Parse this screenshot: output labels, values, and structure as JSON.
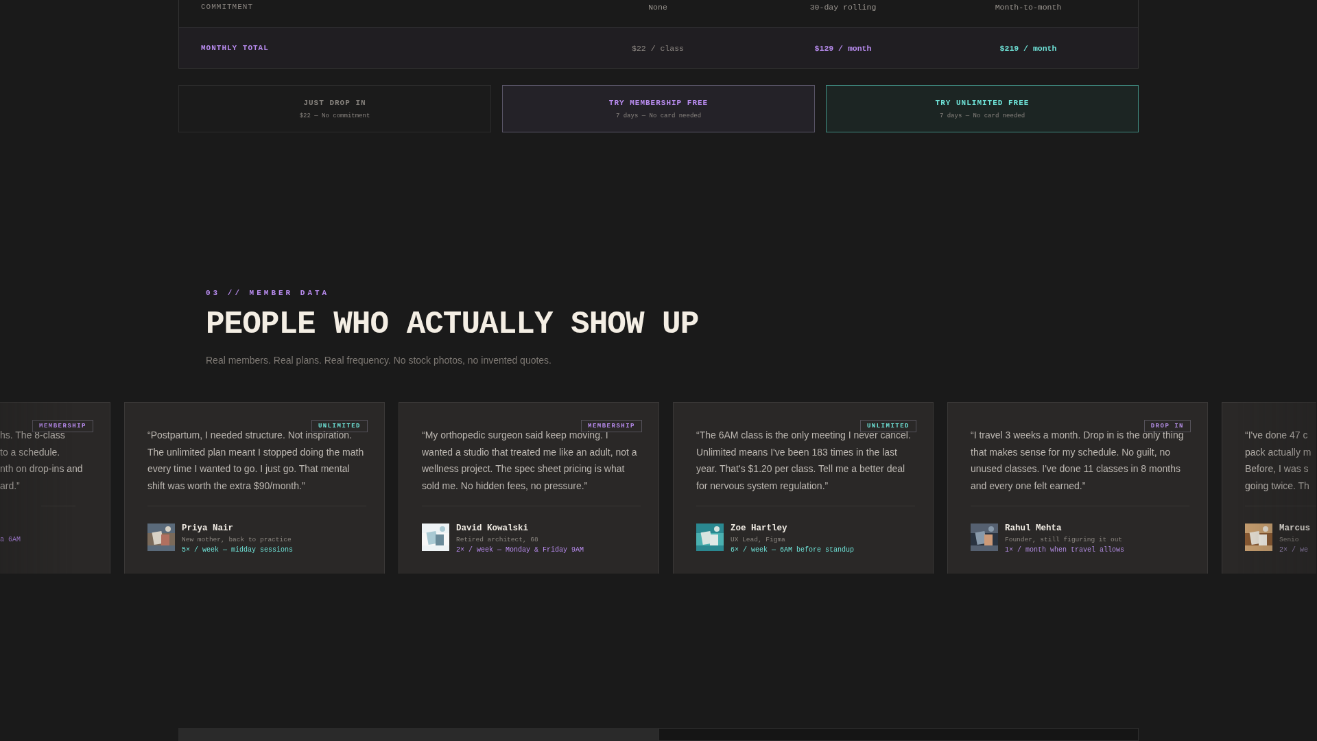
{
  "comparison_table": {
    "rows": [
      {
        "kind": "plain",
        "label": "COMMITMENT",
        "cells": [
          {
            "text": "None",
            "color": "#9a958f"
          },
          {
            "text": "30-day rolling",
            "color": "#9a958f"
          },
          {
            "text": "Month-to-month",
            "color": "#9a958f"
          }
        ]
      },
      {
        "kind": "total",
        "label": "MONTHLY TOTAL",
        "cells": [
          {
            "text": "$22 / class",
            "color": "#8f8a85"
          },
          {
            "text": "$129 / month",
            "color": "#b98cf0"
          },
          {
            "text": "$219 / month",
            "color": "#6fe3d8"
          }
        ]
      }
    ]
  },
  "cta_buttons": [
    {
      "kind": "plain",
      "title": "JUST DROP IN",
      "subtitle": "$22 — No commitment"
    },
    {
      "kind": "membership",
      "title": "TRY MEMBERSHIP FREE",
      "subtitle": "7 days — No card needed"
    },
    {
      "kind": "unlimited",
      "title": "TRY UNLIMITED FREE",
      "subtitle": "7 days — No card needed"
    }
  ],
  "section": {
    "eyebrow": "03 // MEMBER DATA",
    "title": "PEOPLE WHO ACTUALLY SHOW UP",
    "subtitle": "Real members. Real plans. Real frequency. No stock photos, no invented quotes."
  },
  "testimonials": [
    {
      "kind": "partial_left",
      "badge": "MEMBERSHIP",
      "color": "#b98cf0",
      "quote_lines": [
        "hs. The 8-class",
        "to a schedule.",
        "nth on drop-ins and",
        "ard.”"
      ],
      "frequency": "a 6AM"
    },
    {
      "kind": "full",
      "badge": "UNLIMITED",
      "color": "#6fe3d8",
      "quote": "“Postpartum, I needed structure. Not inspiration. The unlimited plan meant I stopped doing the math every time I wanted to go. I just go. That mental shift was worth the extra $90/month.”",
      "name": "Priya Nair",
      "role": "New mother, back to practice",
      "frequency": "5× / week — midday sessions"
    },
    {
      "kind": "full",
      "badge": "MEMBERSHIP",
      "color": "#b98cf0",
      "quote": "“My orthopedic surgeon said keep moving. I wanted a studio that treated me like an adult, not a wellness project. The spec sheet pricing is what sold me. No hidden fees, no pressure.”",
      "name": "David Kowalski",
      "role": "Retired architect, 68",
      "frequency": "2× / week — Monday & Friday 9AM"
    },
    {
      "kind": "full",
      "badge": "UNLIMITED",
      "color": "#6fe3d8",
      "quote": "“The 6AM class is the only meeting I never cancel. Unlimited means I've been 183 times in the last year. That's $1.20 per class. Tell me a better deal for nervous system regulation.”",
      "name": "Zoe Hartley",
      "role": "UX Lead, Figma",
      "frequency": "6× / week — 6AM before standup"
    },
    {
      "kind": "full",
      "badge": "DROP IN",
      "color": "#b08be0",
      "quote": "“I travel 3 weeks a month. Drop in is the only thing that makes sense for my schedule. No guilt, no unused classes. I've done 11 classes in 8 months and every one felt earned.”",
      "name": "Rahul Mehta",
      "role": "Founder, still figuring it out",
      "frequency": "1× / month when travel allows"
    },
    {
      "kind": "partial_right",
      "quote_lines": [
        "“I've done 47 c",
        "pack actually m",
        "Before, I was s",
        "going twice. Th"
      ],
      "name": "Marcus",
      "role": "Senio",
      "frequency": "2× / we"
    }
  ]
}
